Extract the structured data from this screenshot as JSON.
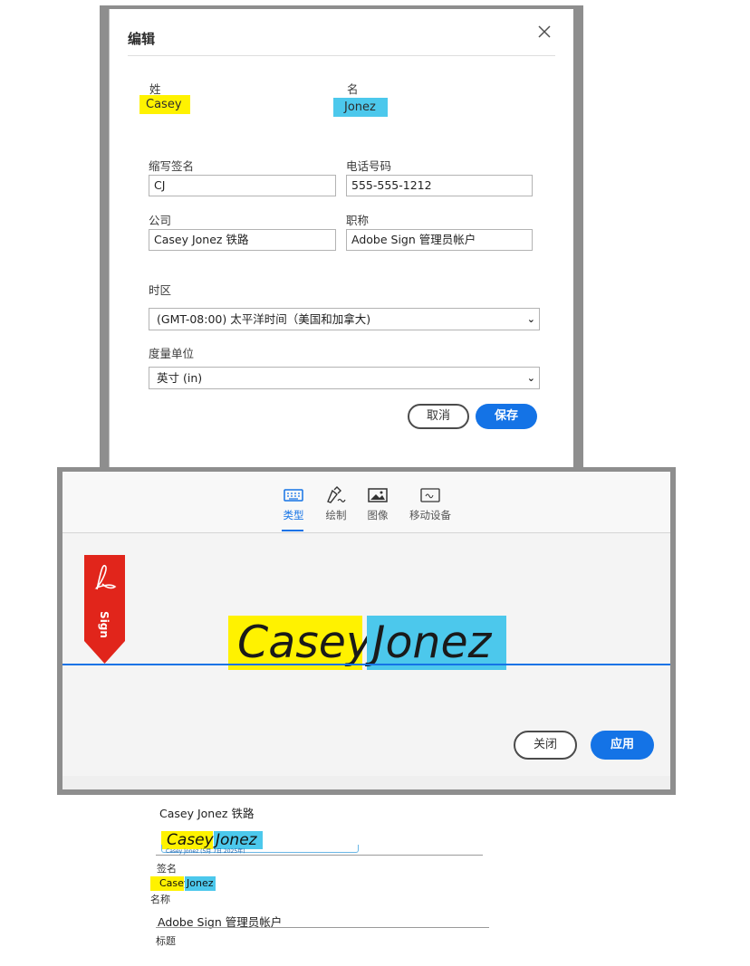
{
  "edit_dialog": {
    "title": "编辑",
    "close_icon": "close-icon",
    "last_name_label": "姓",
    "last_name_value": "Casey",
    "first_name_label": "名",
    "first_name_value": "Jonez",
    "initials_label": "缩写签名",
    "initials_value": "CJ",
    "phone_label": "电话号码",
    "phone_value": "555-555-1212",
    "company_label": "公司",
    "company_value": "Casey Jonez 铁路",
    "title_label": "职称",
    "title_value": "Adobe Sign 管理员帐户",
    "timezone_label": "时区",
    "timezone_value": "(GMT-08:00) 太平洋时间（美国和加拿大)",
    "units_label": "度量单位",
    "units_value": "英寸 (in)",
    "cancel_label": "取消",
    "save_label": "保存"
  },
  "signature_panel": {
    "tabs": [
      {
        "label": "类型",
        "icon": "keyboard-icon",
        "active": true
      },
      {
        "label": "绘制",
        "icon": "pen-draw-icon",
        "active": false
      },
      {
        "label": "图像",
        "icon": "image-icon",
        "active": false
      },
      {
        "label": "移动设备",
        "icon": "mobile-device-icon",
        "active": false
      }
    ],
    "ribbon_text": "Sign",
    "signature_first": "Casey",
    "signature_last": "Jonez",
    "close_label": "关闭",
    "apply_label": "应用"
  },
  "document_preview": {
    "company": "Casey Jonez 铁路",
    "signature_first": "Casey",
    "signature_last": "Jonez",
    "signature_caption": "Casey Jonez (5月 7日 2025年)",
    "signature_label": "签名",
    "name_first": "Casey",
    "name_last": "Jonez",
    "name_label": "名称",
    "title_value": "Adobe Sign 管理员帐户",
    "title_label": "标题"
  },
  "colors": {
    "accent_blue": "#1473e6",
    "highlight_yellow": "#fff200",
    "highlight_cyan": "#4cc8ec",
    "adobe_red": "#e1251b"
  }
}
